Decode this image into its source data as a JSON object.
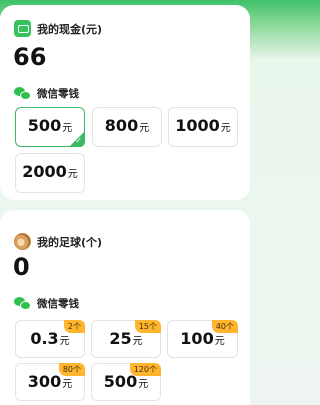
{
  "cash": {
    "title": "我的现金(元)",
    "amount": "66",
    "method": "微信零钱",
    "unit": "元",
    "options": [
      {
        "value": "500",
        "selected": true
      },
      {
        "value": "800",
        "selected": false
      },
      {
        "value": "1000",
        "selected": false
      },
      {
        "value": "2000",
        "selected": false
      }
    ]
  },
  "football": {
    "title": "我的足球(个)",
    "amount": "0",
    "method": "微信零钱",
    "unit": "元",
    "options": [
      {
        "value": "0.3",
        "cost": "2个"
      },
      {
        "value": "25",
        "cost": "15个"
      },
      {
        "value": "100",
        "cost": "40个"
      },
      {
        "value": "300",
        "cost": "80个"
      },
      {
        "value": "500",
        "cost": "120个"
      }
    ]
  },
  "colors": {
    "accent": "#3cb862",
    "badge": "#ffb52e"
  },
  "icons": [
    "wallet-icon",
    "wechat-icon",
    "football-icon",
    "check-icon"
  ]
}
